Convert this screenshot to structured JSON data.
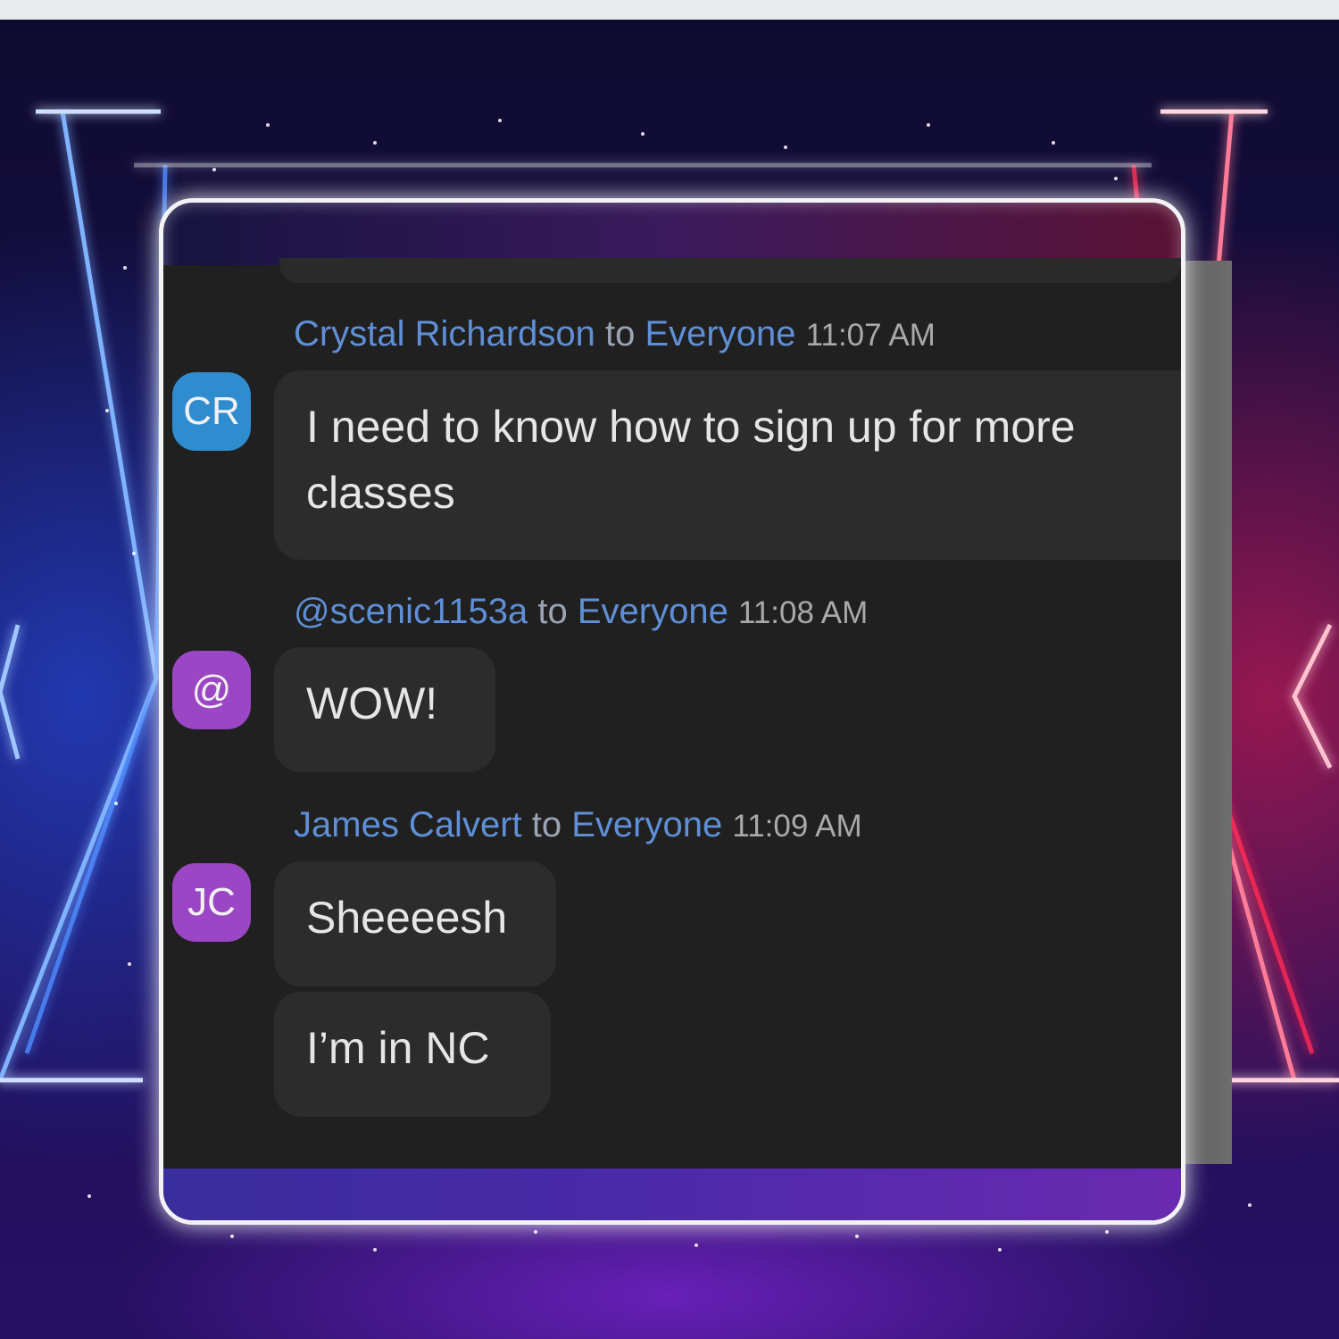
{
  "messages": [
    {
      "avatar": "CR",
      "sender": "Crystal Richardson",
      "to_word": "to",
      "recipient": "Everyone",
      "time": "11:07 AM",
      "bubbles": [
        "I need to know how to sign up for more classes"
      ]
    },
    {
      "avatar": "@",
      "sender": "@scenic1153a",
      "to_word": "to",
      "recipient": "Everyone",
      "time": "11:08 AM",
      "bubbles": [
        "WOW!"
      ]
    },
    {
      "avatar": "JC",
      "sender": "James Calvert",
      "to_word": "to",
      "recipient": "Everyone",
      "time": "11:09 AM",
      "bubbles": [
        "Sheeeesh",
        "I’m in NC"
      ]
    }
  ],
  "colors": {
    "chat_background": "#202020",
    "bubble": "#2c2c2c",
    "sender_link": "#5f8fd6",
    "avatar_blue": "#2f8ccf",
    "avatar_purple": "#9b46c4",
    "neon_blue": "#4f8cff",
    "neon_red": "#ff2a55"
  }
}
